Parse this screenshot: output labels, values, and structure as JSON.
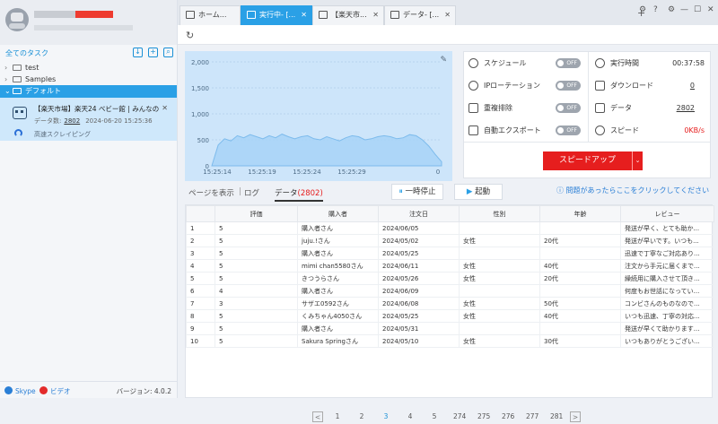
{
  "sidebar": {
    "all_tasks_label": "全てのタスク",
    "tree": [
      {
        "label": "test"
      },
      {
        "label": "Samples"
      },
      {
        "label": "デフォルト"
      }
    ],
    "task": {
      "title": "【楽天市場】楽天24 ベビー館 | みんなのレ...",
      "data_label": "データ数:",
      "data_count": "2802",
      "time": "2024-06-20 15:25:36",
      "mode": "高速スクレイピング"
    },
    "footer": {
      "skype": "Skype",
      "video": "ビデオ",
      "version": "バージョン: 4.0.2"
    }
  },
  "tabs": [
    {
      "label": "ホーム..."
    },
    {
      "label": "実行中- [..."
    },
    {
      "label": "【楽天市..."
    },
    {
      "label": "データ- [..."
    }
  ],
  "window_controls": [
    "⚙",
    "?",
    "⚙",
    "—",
    "☐",
    "✕"
  ],
  "chart_data": {
    "type": "area",
    "y_ticks": [
      "2,000",
      "1,500",
      "1,000",
      "500",
      "0"
    ],
    "x_ticks": [
      "15:25:14",
      "15:25:19",
      "15:25:24",
      "15:25:29"
    ],
    "ylim": [
      0,
      2000
    ],
    "x_end_label": "0",
    "values": [
      0,
      400,
      520,
      480,
      580,
      540,
      600,
      560,
      520,
      580,
      540,
      610,
      560,
      520,
      560,
      580,
      520,
      500,
      560,
      520,
      480,
      540,
      580,
      560,
      500,
      520,
      560,
      580,
      560,
      520,
      540,
      600,
      580,
      500,
      380,
      220,
      80
    ],
    "color": "#a7d4f7"
  },
  "stats": {
    "schedule": {
      "label": "スケジュール",
      "toggle": "OFF"
    },
    "ip_rotation": {
      "label": "IPローテーション",
      "toggle": "OFF"
    },
    "dedup": {
      "label": "重複排除",
      "toggle": "OFF"
    },
    "auto_export": {
      "label": "自動エクスポート",
      "toggle": "OFF"
    },
    "run_time": {
      "label": "実行時間",
      "value": "00:37:58"
    },
    "download": {
      "label": "ダウンロード",
      "value": "0"
    },
    "data": {
      "label": "データ",
      "value": "2802"
    },
    "speed": {
      "label": "スピード",
      "value": "0KB/s"
    },
    "speedup_label": "スピードアップ"
  },
  "subtabs": {
    "show_page": "ページを表示",
    "log": "ログ",
    "data_label": "データ",
    "data_count": "(2802)"
  },
  "controls": {
    "pause": "一時停止",
    "start": "起動",
    "help": "問題があったらここをクリックしてください"
  },
  "table": {
    "headers": [
      "",
      "評価",
      "購入者",
      "注文日",
      "性別",
      "年齢",
      "レビュー"
    ],
    "rows": [
      [
        "1",
        "5",
        "購入者さん",
        "2024/06/05",
        "",
        "",
        "発送が早く、とても助か..."
      ],
      [
        "2",
        "5",
        "juju.!さん",
        "2024/05/02",
        "女性",
        "20代",
        "発送が早いです。いつも..."
      ],
      [
        "3",
        "5",
        "購入者さん",
        "2024/05/25",
        "",
        "",
        "迅速で丁寧なご対応あり..."
      ],
      [
        "4",
        "5",
        "mimi chan5580さん",
        "2024/06/11",
        "女性",
        "40代",
        "注文から手元に届くまで..."
      ],
      [
        "5",
        "5",
        "きつうらさん",
        "2024/05/26",
        "女性",
        "20代",
        "繰続用に購入させて頂き..."
      ],
      [
        "6",
        "4",
        "購入者さん",
        "2024/06/09",
        "",
        "",
        "何度もお世話になってい..."
      ],
      [
        "7",
        "3",
        "サザエ0592さん",
        "2024/06/08",
        "女性",
        "50代",
        "コンビさんのものなので..."
      ],
      [
        "8",
        "5",
        "くみちゃん4050さん",
        "2024/05/25",
        "女性",
        "40代",
        "いつも迅速、丁寧の対応..."
      ],
      [
        "9",
        "5",
        "購入者さん",
        "2024/05/31",
        "",
        "",
        "発送が早くて助かります..."
      ],
      [
        "10",
        "5",
        "Sakura Springさん",
        "2024/05/10",
        "女性",
        "30代",
        "いつもありがとうござい..."
      ]
    ]
  },
  "pager": {
    "prev": "<",
    "next": ">",
    "pages": [
      "1",
      "2",
      "3",
      "4",
      "5",
      "274",
      "275",
      "276",
      "277",
      "281"
    ],
    "current": "3"
  }
}
